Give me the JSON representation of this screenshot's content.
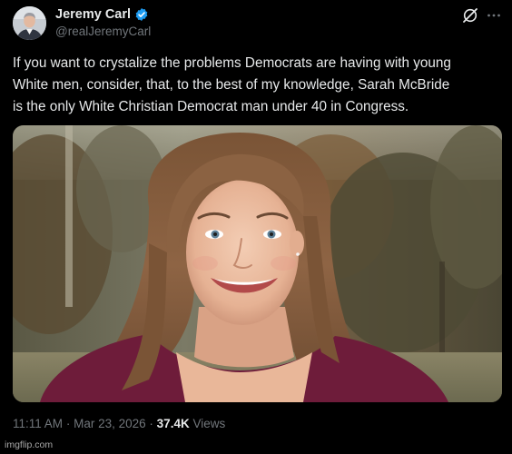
{
  "author": {
    "display_name": "Jeremy Carl",
    "handle": "@realJeremyCarl",
    "verified": true,
    "avatar_icon": "profile-photo"
  },
  "actions": {
    "grok_icon": "grok-icon",
    "more_icon": "more-icon"
  },
  "tweet": {
    "text_lines": [
      "If you want to crystalize the problems Democrats are having with young",
      "White men, consider, that, to the best of my knowledge, Sarah McBride",
      "is the only White Christian Democrat man under 40 in Congress."
    ]
  },
  "media": {
    "type": "photo",
    "icon": "portrait-photo"
  },
  "meta": {
    "time": "11:11 AM",
    "separator": "·",
    "date": "Mar 23, 2026",
    "views_count": "37.4K",
    "views_label": "Views"
  },
  "watermark": {
    "text": "imgflip.com"
  },
  "colors": {
    "background": "#000000",
    "primary_text": "#e7e9ea",
    "secondary_text": "#71767b",
    "verified_badge": "#1d9bf0"
  }
}
